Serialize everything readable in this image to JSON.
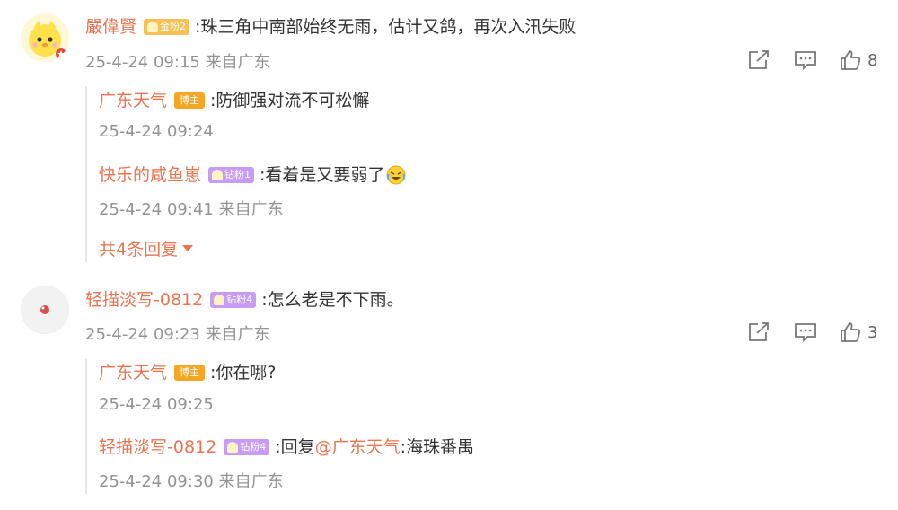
{
  "comments": [
    {
      "username": "嚴偉賢",
      "badge": "金粉2",
      "text": ":珠三角中南部始终无雨，估计又鸽，再次入汛失败",
      "timestamp": "25-4-24 09:15",
      "location": "来自广东",
      "like_count": "8",
      "replies": [
        {
          "username": "广东天气",
          "badge": "博主",
          "text": ":防御强对流不可松懈",
          "timestamp": "25-4-24 09:24",
          "location": ""
        },
        {
          "username": "快乐的咸鱼崽",
          "badge": "钻粉1",
          "text": ":看着是又要弱了",
          "emoji": "laughing-crying-emoji",
          "timestamp": "25-4-24 09:41",
          "location": "来自广东"
        }
      ],
      "more_replies": "共4条回复"
    },
    {
      "username": "轻描淡写-0812",
      "badge": "钻粉4",
      "text": ":怎么老是不下雨。",
      "timestamp": "25-4-24 09:23",
      "location": "来自广东",
      "like_count": "3",
      "replies": [
        {
          "username": "广东天气",
          "badge": "博主",
          "text": ":你在哪?",
          "timestamp": "25-4-24 09:25",
          "location": ""
        },
        {
          "username": "轻描淡写-0812",
          "badge": "钻粉4",
          "text_prefix": ":回复",
          "mention": "@广东天气",
          "text_suffix": ":海珠番禺",
          "timestamp": "25-4-24 09:30",
          "location": "来自广东"
        }
      ]
    }
  ],
  "icons": {
    "share": "share-icon",
    "comment": "comment-icon",
    "like": "thumbs-up-icon"
  },
  "colors": {
    "username": "#eb7350",
    "meta": "#939393",
    "text": "#333333"
  }
}
